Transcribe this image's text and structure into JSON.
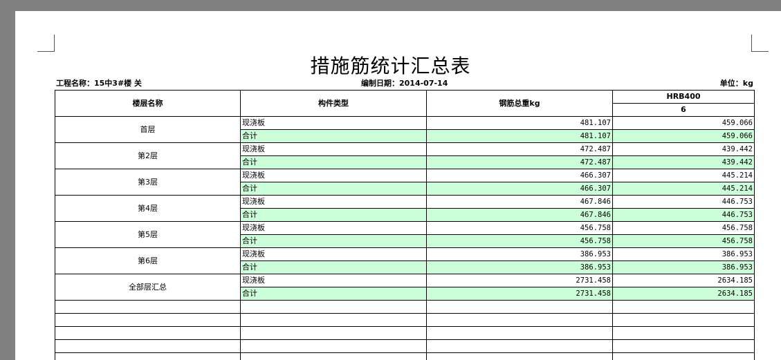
{
  "report": {
    "title": "措施筋统计汇总表",
    "project_label": "工程名称：15中3#楼 关",
    "date_label": "编制日期：2014-07-14",
    "unit_label": "单位：kg"
  },
  "table": {
    "headers": {
      "floor": "楼层名称",
      "component": "构件类型",
      "total_weight": "钢筋总重kg",
      "grade": "HRB400",
      "diameter": "6"
    },
    "groups": [
      {
        "floor": "首层",
        "rows": [
          {
            "type": "现浇板",
            "total": "481.107",
            "d6": "459.066"
          },
          {
            "type": "合计",
            "total": "481.107",
            "d6": "459.066"
          }
        ]
      },
      {
        "floor": "第2层",
        "rows": [
          {
            "type": "现浇板",
            "total": "472.487",
            "d6": "439.442"
          },
          {
            "type": "合计",
            "total": "472.487",
            "d6": "439.442"
          }
        ]
      },
      {
        "floor": "第3层",
        "rows": [
          {
            "type": "现浇板",
            "total": "466.307",
            "d6": "445.214"
          },
          {
            "type": "合计",
            "total": "466.307",
            "d6": "445.214"
          }
        ]
      },
      {
        "floor": "第4层",
        "rows": [
          {
            "type": "现浇板",
            "total": "467.846",
            "d6": "446.753"
          },
          {
            "type": "合计",
            "total": "467.846",
            "d6": "446.753"
          }
        ]
      },
      {
        "floor": "第5层",
        "rows": [
          {
            "type": "现浇板",
            "total": "456.758",
            "d6": "456.758"
          },
          {
            "type": "合计",
            "total": "456.758",
            "d6": "456.758"
          }
        ]
      },
      {
        "floor": "第6层",
        "rows": [
          {
            "type": "现浇板",
            "total": "386.953",
            "d6": "386.953"
          },
          {
            "type": "合计",
            "total": "386.953",
            "d6": "386.953"
          }
        ]
      },
      {
        "floor": "全部层汇总",
        "rows": [
          {
            "type": "现浇板",
            "total": "2731.458",
            "d6": "2634.185"
          },
          {
            "type": "合计",
            "total": "2731.458",
            "d6": "2634.185"
          }
        ]
      }
    ]
  },
  "colors": {
    "window_background": "#808080",
    "page": "#ffffff",
    "total_row_fill": "#ccffd9"
  }
}
